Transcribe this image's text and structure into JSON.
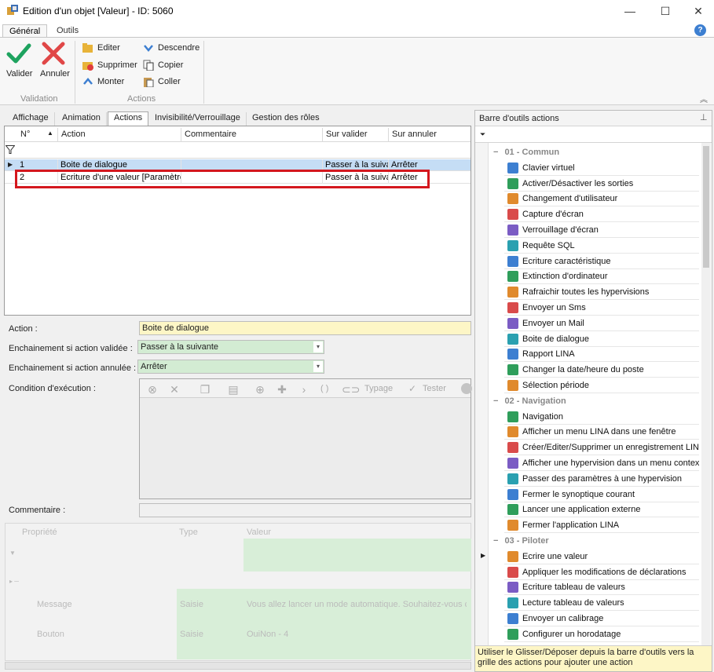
{
  "window": {
    "title": "Edition d'un objet [Valeur] - ID: 5060",
    "minimize": "—",
    "maximize": "☐",
    "close": "✕"
  },
  "ribbon": {
    "tabs": [
      "Général",
      "Outils"
    ],
    "help": "?",
    "validation": {
      "validate": "Valider",
      "cancel": "Annuler",
      "group": "Validation"
    },
    "actions": {
      "edit": "Editer",
      "delete": "Supprimer",
      "up": "Monter",
      "down": "Descendre",
      "copy": "Copier",
      "paste": "Coller",
      "group": "Actions"
    }
  },
  "panel_tabs": [
    "Affichage",
    "Animation",
    "Actions",
    "Invisibilité/Verrouillage",
    "Gestion des rôles"
  ],
  "grid": {
    "columns": [
      "N°",
      "Action",
      "Commentaire",
      "Sur valider",
      "Sur annuler"
    ],
    "rows": [
      {
        "n": "1",
        "action": "Boite de dialogue",
        "comment": "",
        "on_validate": "Passer à la suivante",
        "on_cancel": "Arrêter"
      },
      {
        "n": "2",
        "action": "Ecriture d'une valeur [Paramètres]",
        "comment": "",
        "on_validate": "Passer à la suivante",
        "on_cancel": "Arrêter"
      }
    ]
  },
  "form": {
    "action_label": "Action :",
    "action_value": "Boite de dialogue",
    "on_validate_label": "Enchainement si action validée :",
    "on_validate_value": "Passer à la suivante",
    "on_cancel_label": "Enchainement si action annulée :",
    "on_cancel_value": "Arrêter",
    "condition_label": "Condition d'exécution :",
    "condition_toolbar": {
      "typage": "Typage",
      "tester": "Tester",
      "parens": "( )"
    },
    "comment_label": "Commentaire :"
  },
  "props": {
    "columns": [
      "Propriété",
      "Type",
      "Valeur"
    ],
    "rows": [
      {
        "name": "Message",
        "type": "Saisie",
        "value": "Vous allez lancer un mode automatique. Souhaitez-vous co..."
      },
      {
        "name": "Bouton",
        "type": "Saisie",
        "value": "OuiNon - 4"
      }
    ]
  },
  "toolbox": {
    "title": "Barre d'outils actions",
    "groups": [
      {
        "name": "01 - Commun",
        "items": [
          {
            "label": "Clavier virtuel",
            "icon": "keyboard-icon"
          },
          {
            "label": "Activer/Désactiver les sorties",
            "icon": "toggle-outputs-icon"
          },
          {
            "label": "Changement d'utilisateur",
            "icon": "user-change-icon"
          },
          {
            "label": "Capture d'écran",
            "icon": "screenshot-icon"
          },
          {
            "label": "Verrouillage d'écran",
            "icon": "lock-icon"
          },
          {
            "label": "Requête SQL",
            "icon": "database-icon"
          },
          {
            "label": "Ecriture caractéristique",
            "icon": "grid-icon"
          },
          {
            "label": "Extinction d'ordinateur",
            "icon": "power-icon"
          },
          {
            "label": "Rafraichir toutes les hypervisions",
            "icon": "refresh-icon"
          },
          {
            "label": "Envoyer un Sms",
            "icon": "sms-icon"
          },
          {
            "label": "Envoyer un Mail",
            "icon": "mail-icon"
          },
          {
            "label": "Boite de dialogue",
            "icon": "dialog-icon"
          },
          {
            "label": "Rapport LINA",
            "icon": "pdf-icon"
          },
          {
            "label": "Changer la date/heure du poste",
            "icon": "clock-icon"
          },
          {
            "label": "Sélection période",
            "icon": "period-icon"
          }
        ]
      },
      {
        "name": "02 - Navigation",
        "items": [
          {
            "label": "Navigation",
            "icon": "arrow-right-icon"
          },
          {
            "label": "Afficher un menu LINA dans une fenêtre",
            "icon": "menu-window-icon"
          },
          {
            "label": "Créer/Editer/Supprimer un enregistrement LINA",
            "icon": "record-icon"
          },
          {
            "label": "Afficher une hypervision dans un menu context...",
            "icon": "hypervision-icon"
          },
          {
            "label": "Passer des paramètres à une hypervision",
            "icon": "params-icon"
          },
          {
            "label": "Fermer le synoptique courant",
            "icon": "close-synoptic-icon"
          },
          {
            "label": "Lancer une application externe",
            "icon": "launch-app-icon"
          },
          {
            "label": "Fermer l'application LINA",
            "icon": "exit-app-icon"
          }
        ]
      },
      {
        "name": "03 - Piloter",
        "items": [
          {
            "label": "Ecrire une valeur",
            "icon": "write-value-icon"
          },
          {
            "label": "Appliquer les modifications de déclarations",
            "icon": "apply-icon"
          },
          {
            "label": "Ecriture tableau de valeurs",
            "icon": "table-write-icon"
          },
          {
            "label": "Lecture tableau de valeurs",
            "icon": "table-read-icon"
          },
          {
            "label": "Envoyer un calibrage",
            "icon": "calibration-icon"
          },
          {
            "label": "Configurer un horodatage",
            "icon": "timestamp-icon"
          }
        ]
      }
    ],
    "hint": "Utiliser le Glisser/Déposer depuis la barre d'outils vers la grille des actions pour ajouter une action"
  }
}
